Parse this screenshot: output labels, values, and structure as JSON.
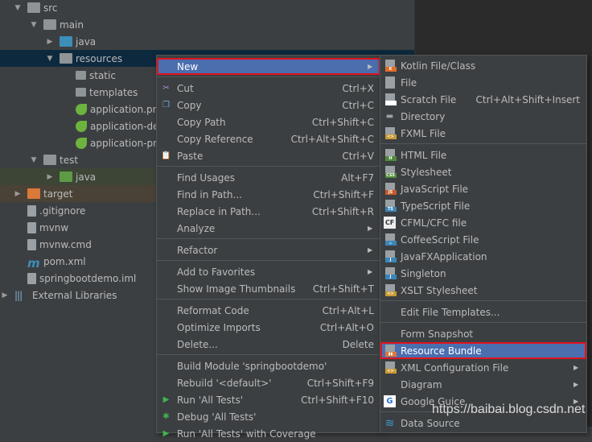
{
  "tree": [
    {
      "label": "src",
      "depth": 1,
      "expanded": true,
      "icon": "folder"
    },
    {
      "label": "main",
      "depth": 2,
      "expanded": true,
      "icon": "folder"
    },
    {
      "label": "java",
      "depth": 3,
      "expanded": false,
      "icon": "folder-blue"
    },
    {
      "label": "resources",
      "depth": 3,
      "expanded": true,
      "icon": "folder-resources",
      "selected": true
    },
    {
      "label": "static",
      "depth": 4,
      "icon": "folder-small"
    },
    {
      "label": "templates",
      "depth": 4,
      "icon": "folder-small"
    },
    {
      "label": "application.pr",
      "depth": 4,
      "icon": "spring-config"
    },
    {
      "label": "application-de",
      "depth": 4,
      "icon": "spring-config"
    },
    {
      "label": "application-pr",
      "depth": 4,
      "icon": "spring-config"
    },
    {
      "label": "test",
      "depth": 2,
      "expanded": true,
      "icon": "folder"
    },
    {
      "label": "java",
      "depth": 3,
      "expanded": false,
      "icon": "folder-green",
      "style": "test"
    },
    {
      "label": "target",
      "depth": 1,
      "expanded": false,
      "icon": "folder-orange",
      "style": "target"
    },
    {
      "label": ".gitignore",
      "depth": 1,
      "icon": "file"
    },
    {
      "label": "mvnw",
      "depth": 1,
      "icon": "file"
    },
    {
      "label": "mvnw.cmd",
      "depth": 1,
      "icon": "file"
    },
    {
      "label": "pom.xml",
      "depth": 1,
      "icon": "maven"
    },
    {
      "label": "springbootdemo.iml",
      "depth": 1,
      "icon": "file"
    },
    {
      "label": "External Libraries",
      "depth": 0,
      "expanded": false,
      "icon": "libraries"
    }
  ],
  "context_menu": [
    {
      "label": "New",
      "submenu": true,
      "highlighted": true
    },
    {
      "sep": true
    },
    {
      "label": "Cut",
      "shortcut": "Ctrl+X",
      "icon": "scissors"
    },
    {
      "label": "Copy",
      "shortcut": "Ctrl+C",
      "icon": "copy"
    },
    {
      "label": "Copy Path",
      "shortcut": "Ctrl+Shift+C"
    },
    {
      "label": "Copy Reference",
      "shortcut": "Ctrl+Alt+Shift+C"
    },
    {
      "label": "Paste",
      "shortcut": "Ctrl+V",
      "icon": "paste"
    },
    {
      "sep": true
    },
    {
      "label": "Find Usages",
      "shortcut": "Alt+F7"
    },
    {
      "label": "Find in Path...",
      "shortcut": "Ctrl+Shift+F"
    },
    {
      "label": "Replace in Path...",
      "shortcut": "Ctrl+Shift+R"
    },
    {
      "label": "Analyze",
      "submenu": true
    },
    {
      "sep": true
    },
    {
      "label": "Refactor",
      "submenu": true
    },
    {
      "sep": true
    },
    {
      "label": "Add to Favorites",
      "submenu": true
    },
    {
      "label": "Show Image Thumbnails",
      "shortcut": "Ctrl+Shift+T"
    },
    {
      "sep": true
    },
    {
      "label": "Reformat Code",
      "shortcut": "Ctrl+Alt+L"
    },
    {
      "label": "Optimize Imports",
      "shortcut": "Ctrl+Alt+O"
    },
    {
      "label": "Delete...",
      "shortcut": "Delete"
    },
    {
      "sep": true
    },
    {
      "label": "Build Module 'springbootdemo'"
    },
    {
      "label": "Rebuild '<default>'",
      "shortcut": "Ctrl+Shift+F9"
    },
    {
      "label": "Run 'All Tests'",
      "shortcut": "Ctrl+Shift+F10",
      "icon": "run"
    },
    {
      "label": "Debug 'All Tests'",
      "icon": "debug"
    },
    {
      "label": "Run 'All Tests' with Coverage",
      "icon": "coverage"
    }
  ],
  "new_submenu": [
    {
      "label": "Kotlin File/Class",
      "icon": "kotlin"
    },
    {
      "label": "File",
      "icon": "file"
    },
    {
      "label": "Scratch File",
      "shortcut": "Ctrl+Alt+Shift+Insert",
      "icon": "scratch"
    },
    {
      "label": "Directory",
      "icon": "folder"
    },
    {
      "label": "FXML File",
      "icon": "xml"
    },
    {
      "sep": true
    },
    {
      "label": "HTML File",
      "icon": "html"
    },
    {
      "label": "Stylesheet",
      "icon": "css"
    },
    {
      "label": "JavaScript File",
      "icon": "js"
    },
    {
      "label": "TypeScript File",
      "icon": "ts"
    },
    {
      "label": "CFML/CFC file",
      "icon": "cf"
    },
    {
      "label": "CoffeeScript File",
      "icon": "coffee"
    },
    {
      "label": "JavaFXApplication",
      "icon": "java"
    },
    {
      "label": "Singleton",
      "icon": "java"
    },
    {
      "label": "XSLT Stylesheet",
      "icon": "xml"
    },
    {
      "sep": true
    },
    {
      "label": "Edit File Templates..."
    },
    {
      "sep": true
    },
    {
      "label": "Form Snapshot"
    },
    {
      "label": "Resource Bundle",
      "icon": "resource-bundle",
      "highlighted": true
    },
    {
      "label": "XML Configuration File",
      "submenu": true,
      "icon": "xml"
    },
    {
      "label": "Diagram",
      "submenu": true
    },
    {
      "label": "Google Guice",
      "submenu": true,
      "icon": "guice"
    },
    {
      "sep": true
    },
    {
      "label": "Data Source",
      "icon": "database"
    }
  ],
  "watermark": "https://baibai.blog.csdn.net",
  "colors": {
    "highlight": "#4b6eaf",
    "highlight_border": "#e0141e",
    "selection": "#0d293e"
  }
}
